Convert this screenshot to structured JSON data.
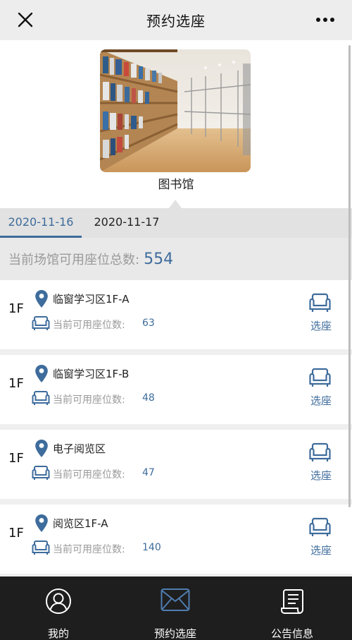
{
  "nav": {
    "title": "预约选座",
    "close_icon": "close-icon",
    "more_icon": "more-icon"
  },
  "venue": {
    "name": "图书馆"
  },
  "tabs": [
    {
      "label": "2020-11-16",
      "active": true
    },
    {
      "label": "2020-11-17",
      "active": false
    }
  ],
  "total": {
    "label": "当前场馆可用座位总数:",
    "value": "554"
  },
  "available_label": "当前可用座位数:",
  "select_label": "选座",
  "areas": [
    {
      "floor": "1F",
      "name": "临窗学习区1F-A",
      "available": "63"
    },
    {
      "floor": "1F",
      "name": "临窗学习区1F-B",
      "available": "48"
    },
    {
      "floor": "1F",
      "name": "电子阅览区",
      "available": "47"
    },
    {
      "floor": "1F",
      "name": "阅览区1F-A",
      "available": "140"
    }
  ],
  "bottom_nav": [
    {
      "label": "我的",
      "icon": "user-icon"
    },
    {
      "label": "预约选座",
      "icon": "envelope-icon"
    },
    {
      "label": "公告信息",
      "icon": "notice-scroll-icon"
    }
  ],
  "colors": {
    "accent": "#3e6c9c",
    "bottom_bar": "#1e1e1e",
    "muted_text": "#999999"
  }
}
